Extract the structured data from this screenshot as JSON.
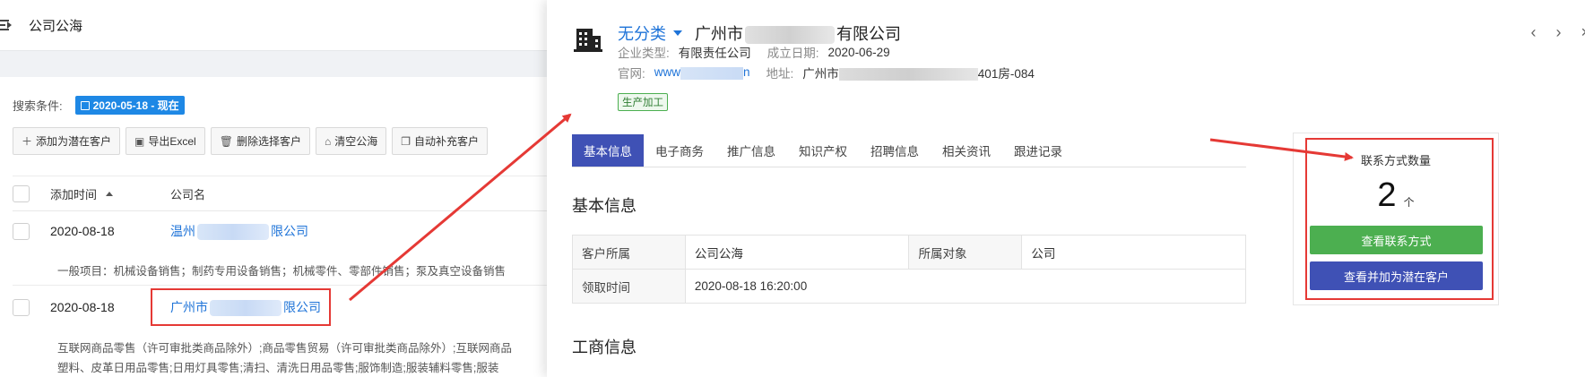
{
  "left": {
    "top_title": "公司公海",
    "search_label": "搜索条件:",
    "date_tag": "2020-05-18 - 现在",
    "actions": [
      {
        "label": "添加为潜在客户",
        "icon": "plus-icon"
      },
      {
        "label": "导出Excel",
        "icon": "excel-icon"
      },
      {
        "label": "删除选择客户",
        "icon": "trash-icon"
      },
      {
        "label": "清空公海",
        "icon": "clear-icon"
      },
      {
        "label": "自动补充客户",
        "icon": "copy-icon"
      }
    ],
    "table": {
      "col_time": "添加时间",
      "col_name": "公司名",
      "rows": [
        {
          "date": "2020-08-18",
          "name_prefix": "温州",
          "name_suffix": "限公司",
          "desc": "一般项目：机械设备销售；制药专用设备销售；机械零件、零部件销售；泵及真空设备销售"
        },
        {
          "date": "2020-08-18",
          "name_prefix": "广州市",
          "name_suffix": "限公司",
          "desc": "互联网商品零售（许可审批类商品除外）;商品零售贸易（许可审批类商品除外）;互联网商品",
          "desc2": "塑料、皮革日用品零售;日用灯具零售;清扫、清洗日用品零售;服饰制造;服装辅料零售;服装"
        }
      ]
    }
  },
  "right": {
    "category": "无分类",
    "company_prefix": "广州市",
    "company_suffix": "有限公司",
    "meta": {
      "type_label": "企业类型:",
      "type_value": "有限责任公司",
      "date_label": "成立日期:",
      "date_value": "2020-06-29",
      "site_label": "官网:",
      "site_prefix": "www",
      "site_suffix": "n",
      "addr_label": "地址:",
      "addr_prefix": "广州市",
      "addr_suffix": "401房-084"
    },
    "tag": "生产加工",
    "tabs": [
      "基本信息",
      "电子商务",
      "推广信息",
      "知识产权",
      "招聘信息",
      "相关资讯",
      "跟进记录"
    ],
    "section_basic": "基本信息",
    "basic_table": [
      [
        "客户所属",
        "公司公海",
        "所属对象",
        "公司"
      ],
      [
        "领取时间",
        "2020-08-18 16:20:00"
      ]
    ],
    "section_business": "工商信息",
    "contact": {
      "title": "联系方式数量",
      "count": "2",
      "unit": "个",
      "view_btn": "查看联系方式",
      "add_btn": "查看并加为潜在客户"
    },
    "colors": {
      "accent": "#3f51b5",
      "link": "#1e73d8",
      "green": "#4caf50",
      "annotation_red": "#e53935"
    }
  }
}
